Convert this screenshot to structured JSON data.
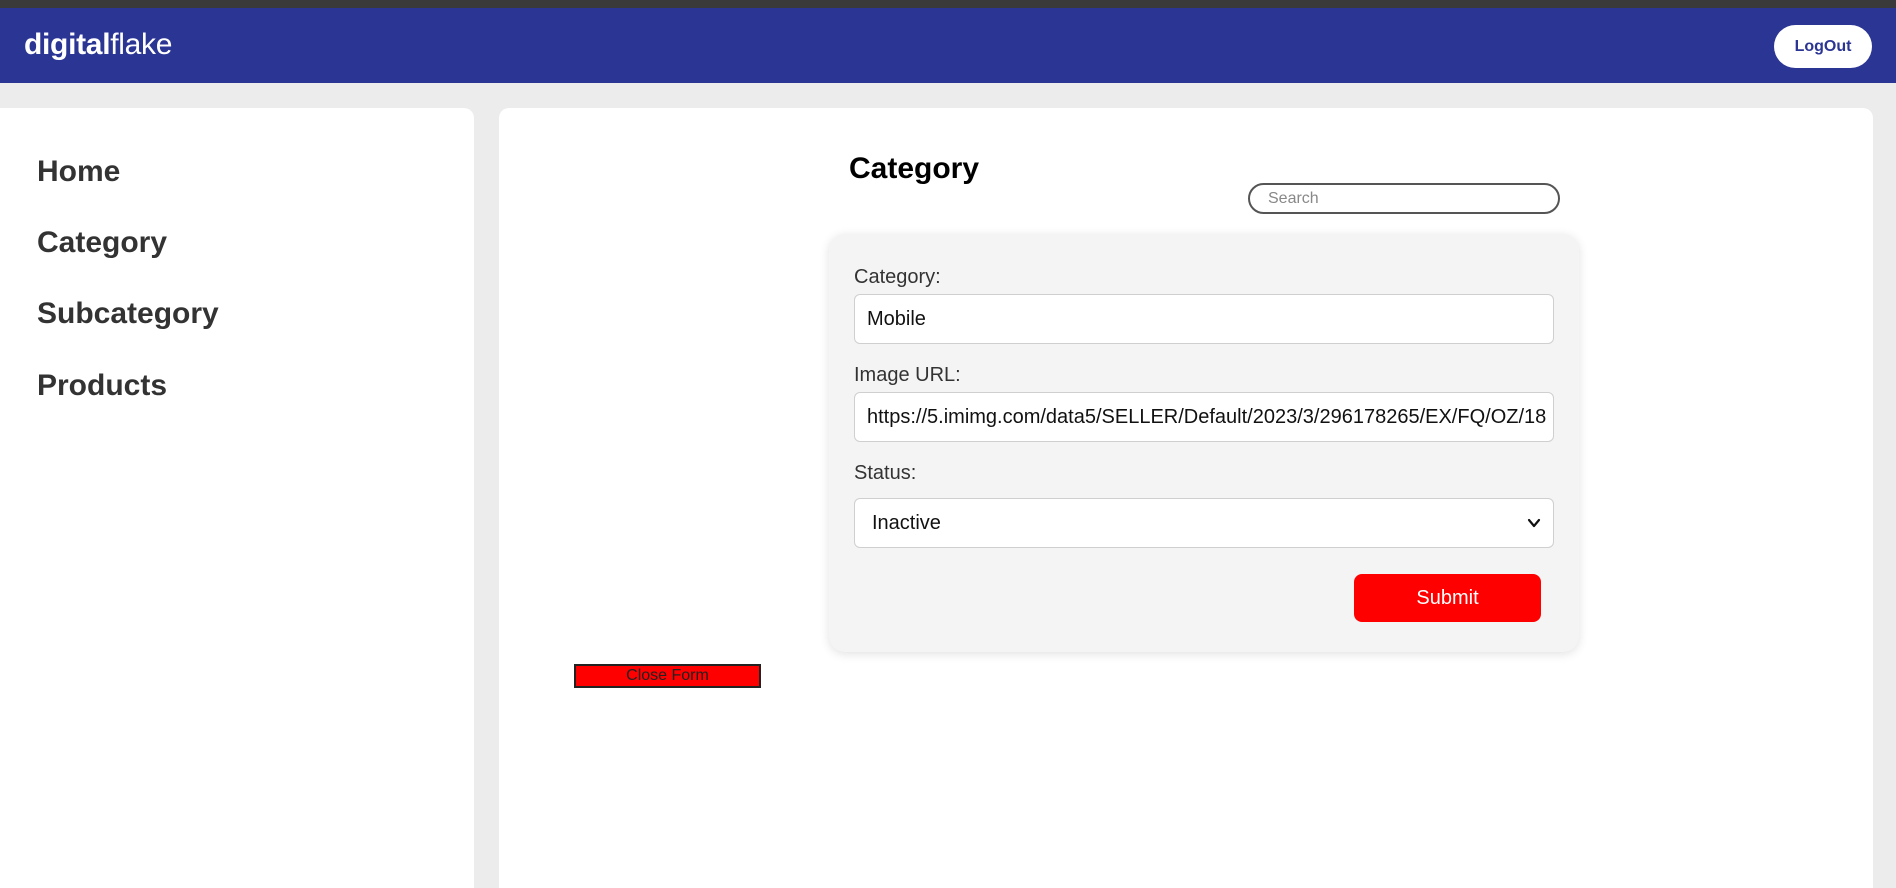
{
  "header": {
    "brand_bold": "digital",
    "brand_light": "flake",
    "logout_label": "LogOut"
  },
  "sidebar": {
    "items": [
      {
        "label": "Home"
      },
      {
        "label": "Category"
      },
      {
        "label": "Subcategory"
      },
      {
        "label": "Products"
      }
    ]
  },
  "main": {
    "title": "Category",
    "search_placeholder": "Search",
    "form": {
      "category_label": "Category:",
      "category_value": "Mobile",
      "image_url_label": "Image URL:",
      "image_url_value": "https://5.imimg.com/data5/SELLER/Default/2023/3/296178265/EX/FQ/OZ/18",
      "status_label": "Status:",
      "status_value": "Inactive",
      "submit_label": "Submit"
    },
    "close_form_label": "Close Form"
  },
  "colors": {
    "header_bg": "#2b3594",
    "accent_red": "#ff0000",
    "page_bg": "#ececec"
  },
  "icons": {
    "status_dropdown": "chevron-down-icon"
  }
}
